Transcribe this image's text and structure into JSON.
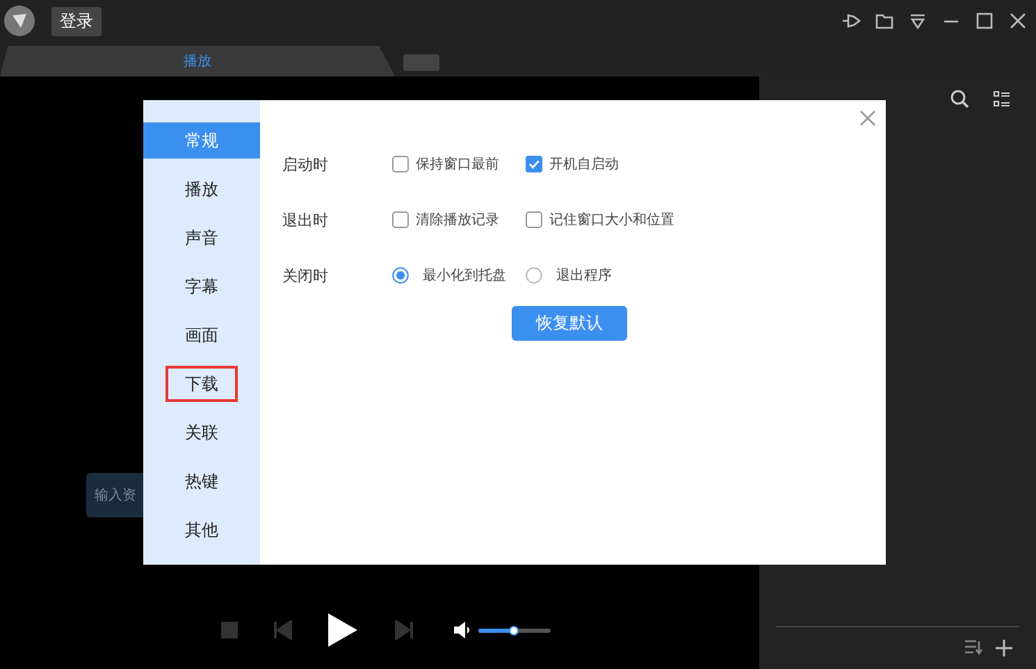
{
  "titlebar": {
    "login_button": "登录"
  },
  "tabs": [
    {
      "label": "播放",
      "selected": true
    }
  ],
  "player": {
    "input_placeholder": "输入资",
    "volume": {
      "level": 0.48
    }
  },
  "dialog": {
    "nav": [
      {
        "label": "常规",
        "selected": true,
        "marked": false
      },
      {
        "label": "播放",
        "selected": false,
        "marked": false
      },
      {
        "label": "声音",
        "selected": false,
        "marked": false
      },
      {
        "label": "字幕",
        "selected": false,
        "marked": false
      },
      {
        "label": "画面",
        "selected": false,
        "marked": false
      },
      {
        "label": "下载",
        "selected": false,
        "marked": true
      },
      {
        "label": "关联",
        "selected": false,
        "marked": false
      },
      {
        "label": "热键",
        "selected": false,
        "marked": false
      },
      {
        "label": "其他",
        "selected": false,
        "marked": false
      }
    ],
    "rows": [
      {
        "label": "启动时",
        "options": [
          {
            "kind": "checkbox",
            "label": "保持窗口最前",
            "checked": false
          },
          {
            "kind": "checkbox",
            "label": "开机自启动",
            "checked": true
          }
        ]
      },
      {
        "label": "退出时",
        "options": [
          {
            "kind": "checkbox",
            "label": "清除播放记录",
            "checked": false
          },
          {
            "kind": "checkbox",
            "label": "记住窗口大小和位置",
            "checked": false
          }
        ]
      },
      {
        "label": "关闭时",
        "options": [
          {
            "kind": "radio",
            "label": "最小化到托盘",
            "checked": true
          },
          {
            "kind": "radio",
            "label": "退出程序",
            "checked": false
          }
        ]
      }
    ],
    "reset_button": "恢复默认"
  }
}
